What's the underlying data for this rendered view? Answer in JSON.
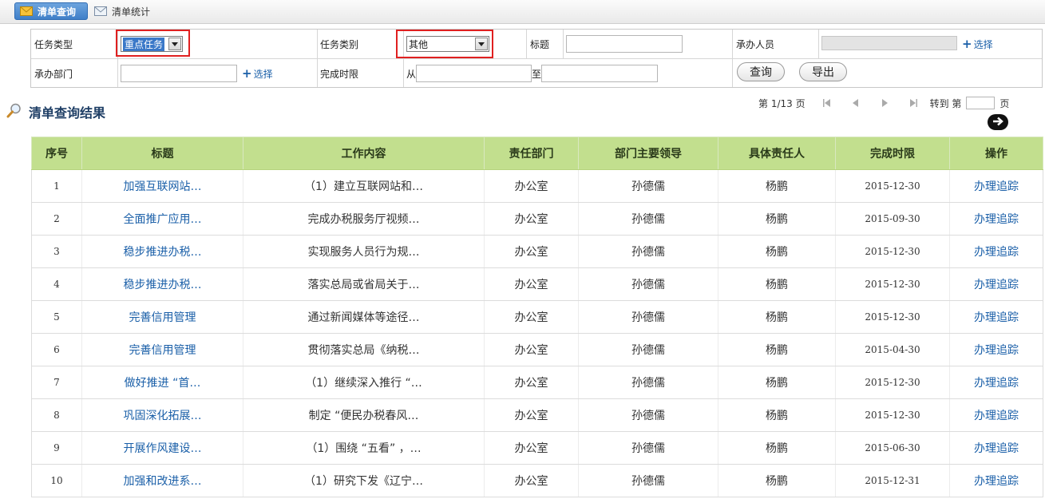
{
  "tabs": [
    {
      "label": "清单查询",
      "icon": "envelope-icon",
      "active": true
    },
    {
      "label": "清单统计",
      "icon": "envelope-icon",
      "active": false
    }
  ],
  "filters": {
    "task_type_label": "任务类型",
    "task_type_value": "重点任务",
    "task_category_label": "任务类别",
    "task_category_value": "其他",
    "title_label": "标题",
    "title_value": "",
    "assignee_label": "承办人员",
    "assignee_value": "",
    "select_link": "选择",
    "department_label": "承办部门",
    "department_value": "",
    "deadline_label": "完成时限",
    "from_label": "从",
    "to_label": "至",
    "from_value": "",
    "to_value": "",
    "query_button": "查询",
    "export_button": "导出"
  },
  "results": {
    "title": "清单查询结果",
    "title_icon": "magnifier-icon"
  },
  "pager": {
    "page_info": "第 1/13 页",
    "goto_prefix": "转到 第",
    "goto_suffix": "页",
    "goto_value": ""
  },
  "table": {
    "columns": [
      "序号",
      "标题",
      "工作内容",
      "责任部门",
      "部门主要领导",
      "具体责任人",
      "完成时限",
      "操作"
    ],
    "rows": [
      [
        "1",
        "加强互联网站…",
        "（1）建立互联网站和…",
        "办公室",
        "孙德儒",
        "杨鹏",
        "2015-12-30",
        "办理追踪"
      ],
      [
        "2",
        "全面推广应用…",
        "完成办税服务厅视频…",
        "办公室",
        "孙德儒",
        "杨鹏",
        "2015-09-30",
        "办理追踪"
      ],
      [
        "3",
        "稳步推进办税…",
        "实现服务人员行为规…",
        "办公室",
        "孙德儒",
        "杨鹏",
        "2015-12-30",
        "办理追踪"
      ],
      [
        "4",
        "稳步推进办税…",
        "落实总局或省局关于…",
        "办公室",
        "孙德儒",
        "杨鹏",
        "2015-12-30",
        "办理追踪"
      ],
      [
        "5",
        "完善信用管理",
        "通过新闻媒体等途径…",
        "办公室",
        "孙德儒",
        "杨鹏",
        "2015-12-30",
        "办理追踪"
      ],
      [
        "6",
        "完善信用管理",
        "贯彻落实总局《纳税…",
        "办公室",
        "孙德儒",
        "杨鹏",
        "2015-04-30",
        "办理追踪"
      ],
      [
        "7",
        "做好推进 “首…",
        "（1）继续深入推行 “…",
        "办公室",
        "孙德儒",
        "杨鹏",
        "2015-12-30",
        "办理追踪"
      ],
      [
        "8",
        "巩固深化拓展…",
        "制定 “便民办税春风…",
        "办公室",
        "孙德儒",
        "杨鹏",
        "2015-12-30",
        "办理追踪"
      ],
      [
        "9",
        "开展作风建设…",
        "（1）围绕 “五看” ，…",
        "办公室",
        "孙德儒",
        "杨鹏",
        "2015-06-30",
        "办理追踪"
      ],
      [
        "10",
        "加强和改进系…",
        "（1）研究下发《辽宁…",
        "办公室",
        "孙德儒",
        "杨鹏",
        "2015-12-31",
        "办理追踪"
      ]
    ]
  },
  "colors": {
    "header_green": "#c2df8e",
    "link_blue": "#1a5fa8",
    "highlight_red": "#e02020",
    "tab_blue": "#3f7fc8"
  }
}
